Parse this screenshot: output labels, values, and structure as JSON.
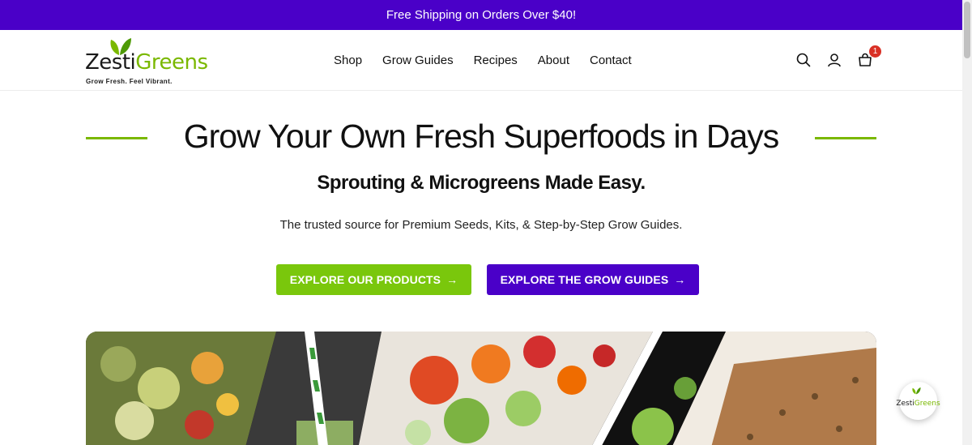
{
  "announcement": "Free Shipping on Orders Over $40!",
  "logo": {
    "word_dark": "Zesti",
    "word_green": "Greens",
    "tagline": "Grow Fresh. Feel Vibrant."
  },
  "nav": {
    "items": [
      {
        "label": "Shop"
      },
      {
        "label": "Grow Guides"
      },
      {
        "label": "Recipes"
      },
      {
        "label": "About"
      },
      {
        "label": "Contact"
      }
    ]
  },
  "header_icons": {
    "search": "search-icon",
    "account": "user-icon",
    "cart": "cart-icon",
    "cart_count": "1"
  },
  "hero": {
    "title": "Grow Your Own Fresh Superfoods in Days",
    "subtitle": "Sprouting & Microgreens Made Easy.",
    "description": "The trusted source for Premium Seeds, Kits, & Step-by-Step Grow Guides.",
    "primary_button": "EXPLORE OUR PRODUCTS",
    "secondary_button": "EXPLORE THE GROW GUIDES",
    "arrow": "→"
  },
  "chat_widget": {
    "word_dark": "Zesti",
    "word_green": "Greens"
  },
  "colors": {
    "brand_purple": "#4a00c8",
    "brand_green": "#7ab800",
    "button_green": "#7ac70c",
    "badge_red": "#d93025"
  }
}
